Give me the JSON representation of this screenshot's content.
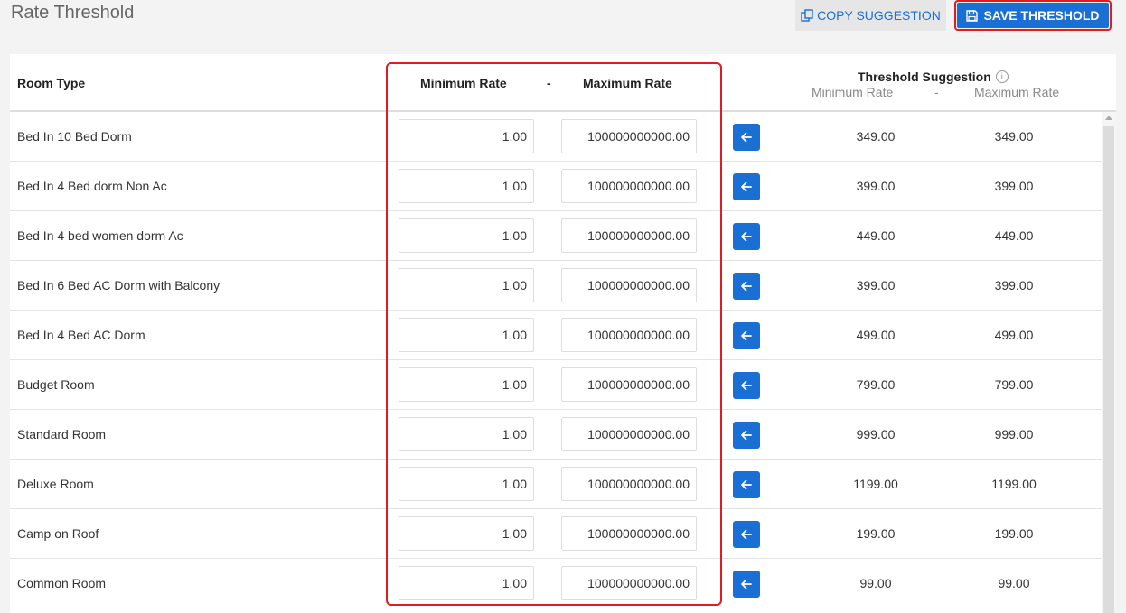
{
  "page": {
    "title": "Rate Threshold"
  },
  "toolbar": {
    "copy_label": "COPY SUGGESTION",
    "copy_icon": "copy-icon",
    "save_label": "SAVE THRESHOLD",
    "save_icon": "save-icon"
  },
  "colors": {
    "accent": "#1a6fd4",
    "highlight": "#e01b24"
  },
  "table": {
    "headers": {
      "room_type": "Room Type",
      "min_rate": "Minimum Rate",
      "dash": "-",
      "max_rate": "Maximum Rate",
      "suggestion": "Threshold Suggestion",
      "sugg_min": "Minimum Rate",
      "sugg_dash": "-",
      "sugg_max": "Maximum Rate"
    },
    "rows": [
      {
        "room": "Bed In 10 Bed Dorm",
        "min": "1.00",
        "max": "100000000000.00",
        "sugg_min": "349.00",
        "sugg_max": "349.00"
      },
      {
        "room": "Bed In 4 Bed dorm Non Ac",
        "min": "1.00",
        "max": "100000000000.00",
        "sugg_min": "399.00",
        "sugg_max": "399.00"
      },
      {
        "room": "Bed In 4 bed women dorm Ac",
        "min": "1.00",
        "max": "100000000000.00",
        "sugg_min": "449.00",
        "sugg_max": "449.00"
      },
      {
        "room": "Bed In 6 Bed AC Dorm with Balcony",
        "min": "1.00",
        "max": "100000000000.00",
        "sugg_min": "399.00",
        "sugg_max": "399.00"
      },
      {
        "room": "Bed In 4 Bed AC Dorm",
        "min": "1.00",
        "max": "100000000000.00",
        "sugg_min": "499.00",
        "sugg_max": "499.00"
      },
      {
        "room": "Budget Room",
        "min": "1.00",
        "max": "100000000000.00",
        "sugg_min": "799.00",
        "sugg_max": "799.00"
      },
      {
        "room": "Standard Room",
        "min": "1.00",
        "max": "100000000000.00",
        "sugg_min": "999.00",
        "sugg_max": "999.00"
      },
      {
        "room": "Deluxe Room",
        "min": "1.00",
        "max": "100000000000.00",
        "sugg_min": "1199.00",
        "sugg_max": "1199.00"
      },
      {
        "room": "Camp on Roof",
        "min": "1.00",
        "max": "100000000000.00",
        "sugg_min": "199.00",
        "sugg_max": "199.00"
      },
      {
        "room": "Common Room",
        "min": "1.00",
        "max": "100000000000.00",
        "sugg_min": "99.00",
        "sugg_max": "99.00"
      }
    ]
  }
}
